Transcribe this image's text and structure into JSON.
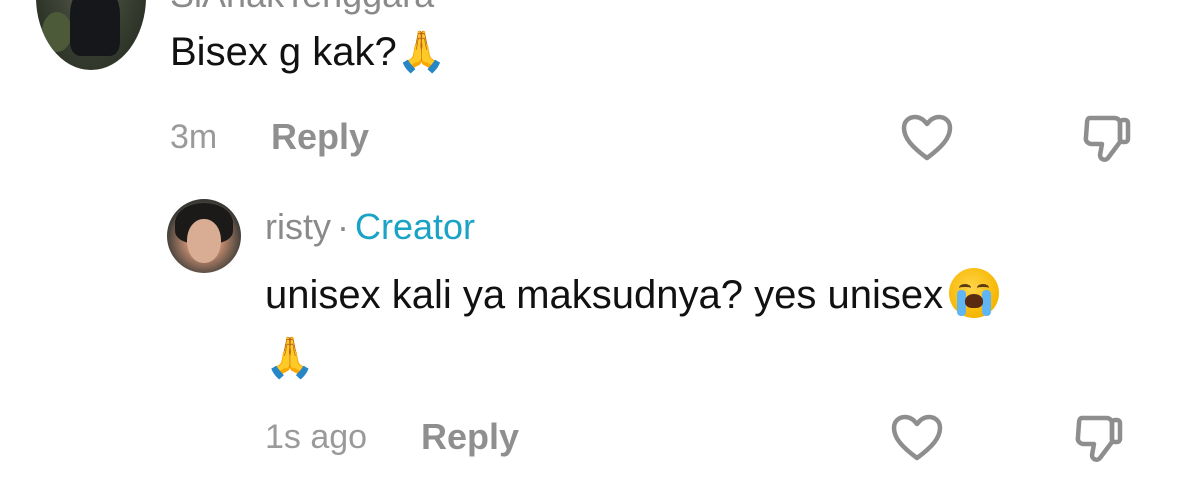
{
  "top_comment": {
    "username": "SiAnakTenggara",
    "text": "Bisex g kak?",
    "emoji": "🙏",
    "timestamp": "3m",
    "reply_label": "Reply",
    "like_icon": "heart-icon",
    "dislike_icon": "thumbs-down-icon"
  },
  "reply_comment": {
    "username": "risty",
    "separator": "·",
    "badge": "Creator",
    "text": "unisex kali ya maksudnya? yes unisex",
    "emoji_line2": "🙏",
    "timestamp": "1s ago",
    "reply_label": "Reply",
    "like_icon": "heart-icon",
    "dislike_icon": "thumbs-down-icon"
  },
  "colors": {
    "creator_badge": "#1aa3c4",
    "muted_text": "#8a8a8a",
    "body_text": "#111111",
    "icon_stroke": "#8e8e8e"
  }
}
